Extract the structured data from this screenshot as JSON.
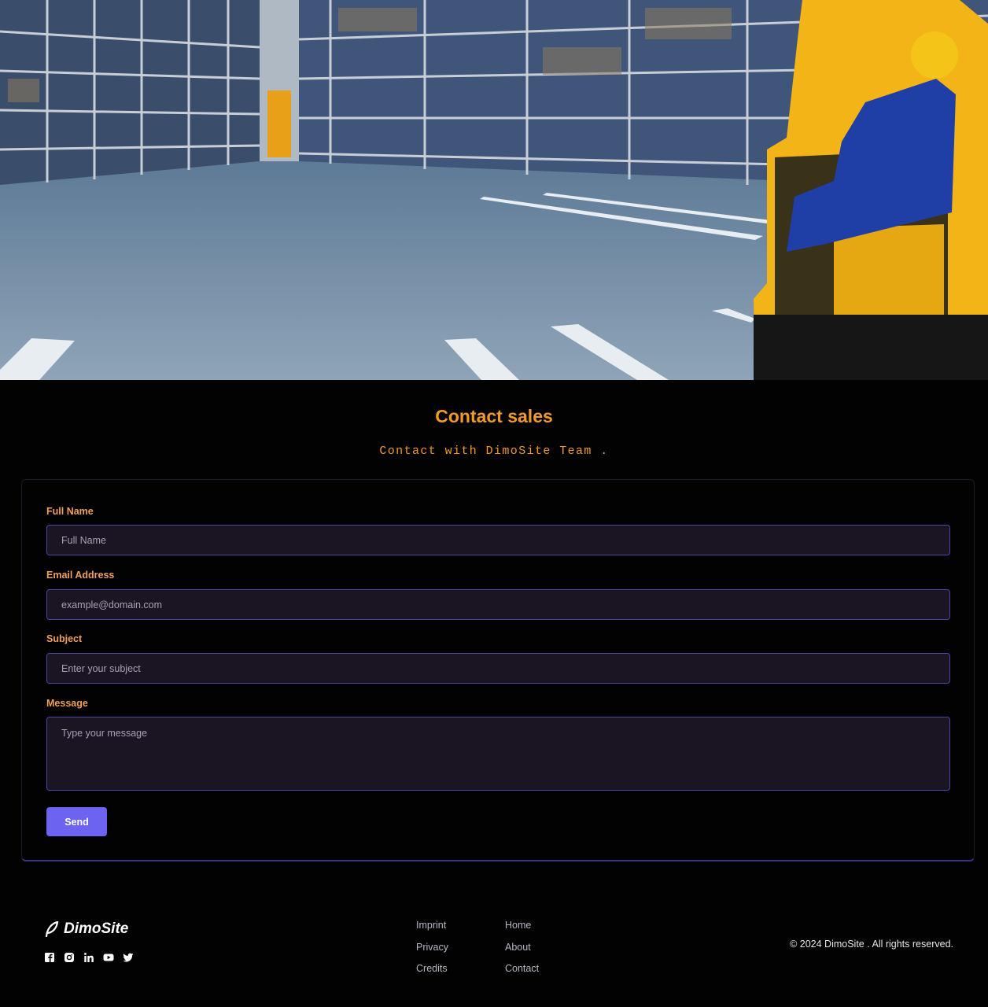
{
  "hero": {
    "image_description": "warehouse-forklift-photo"
  },
  "heading": {
    "title": "Contact sales",
    "subtitle": "Contact with DimoSite Team ."
  },
  "form": {
    "fields": [
      {
        "label": "Full Name",
        "placeholder": "Full Name"
      },
      {
        "label": "Email Address",
        "placeholder": "example@domain.com"
      },
      {
        "label": "Subject",
        "placeholder": "Enter your subject"
      },
      {
        "label": "Message",
        "placeholder": "Type your message"
      }
    ],
    "submit_label": "Send"
  },
  "footer": {
    "brand": "DimoSite",
    "socials": [
      "facebook-icon",
      "instagram-icon",
      "linkedin-icon",
      "youtube-icon",
      "twitter-icon"
    ],
    "links_col1": [
      "Imprint",
      "Privacy",
      "Credits"
    ],
    "links_col2": [
      "Home",
      "About",
      "Contact"
    ],
    "copyright": "© 2024 DimoSite . All rights reserved."
  },
  "colors": {
    "accent": "#f29a27",
    "button": "#6c63f0",
    "field_border": "#4d45a8",
    "field_bg": "#1b1422",
    "background": "#020203"
  }
}
